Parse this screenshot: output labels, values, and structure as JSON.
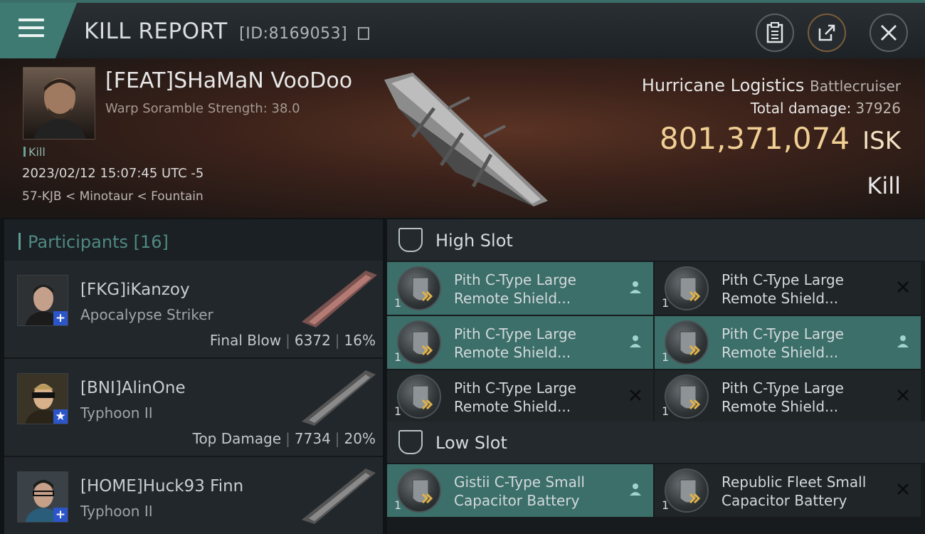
{
  "header": {
    "title": "KILL REPORT",
    "id_label": "[ID:8169053]"
  },
  "victim": {
    "name": "[FEAT]SHaMaN VooDoo",
    "sub": "Warp Soramble Strength: 38.0",
    "tag": "Kill",
    "time": "2023/02/12 15:07:45 UTC -5",
    "location": "57-KJB < Minotaur < Fountain",
    "ship_name": "Hurricane Logistics",
    "ship_class": "Battlecruiser",
    "total_damage_label": "Total damage:",
    "total_damage": "37926",
    "isk_value": "801,371,074",
    "isk_unit": "ISK",
    "result": "Kill"
  },
  "participants": {
    "label": "Participants",
    "count": "[16]",
    "rows": [
      {
        "name": "[FKG]iKanzoy",
        "ship": "Apocalypse Striker",
        "role": "Final Blow",
        "damage": "6372",
        "pct": "16%",
        "badge": "+"
      },
      {
        "name": "[BNI]AlinOne",
        "ship": "Typhoon II",
        "role": "Top Damage",
        "damage": "7734",
        "pct": "20%",
        "badge": "★"
      },
      {
        "name": "[HOME]Huck93 Finn",
        "ship": "Typhoon II",
        "role": "",
        "damage": "",
        "pct": "",
        "badge": "+"
      }
    ]
  },
  "slots": {
    "high": {
      "label": "High Slot",
      "items": [
        {
          "name": "Pith C-Type Large Remote Shield...",
          "qty": "1",
          "status": "person",
          "active": true
        },
        {
          "name": "Pith C-Type Large Remote Shield...",
          "qty": "1",
          "status": "x",
          "active": false
        },
        {
          "name": "Pith C-Type Large Remote Shield...",
          "qty": "1",
          "status": "person",
          "active": true
        },
        {
          "name": "Pith C-Type Large Remote Shield...",
          "qty": "1",
          "status": "person",
          "active": true
        },
        {
          "name": "Pith C-Type Large Remote Shield...",
          "qty": "1",
          "status": "x",
          "active": false
        },
        {
          "name": "Pith C-Type Large Remote Shield...",
          "qty": "1",
          "status": "x",
          "active": false
        }
      ]
    },
    "low": {
      "label": "Low Slot",
      "items": [
        {
          "name": "Gistii C-Type Small Capacitor Battery",
          "qty": "1",
          "status": "person",
          "active": true
        },
        {
          "name": "Republic Fleet Small Capacitor Battery",
          "qty": "1",
          "status": "x",
          "active": false
        }
      ]
    }
  },
  "icons": [
    "menu-icon",
    "copy-icon",
    "clipboard-icon",
    "share-icon",
    "close-icon",
    "high-slot-icon",
    "low-slot-icon",
    "person-icon",
    "x-icon"
  ],
  "colors": {
    "accent": "#3e7a72",
    "isk": "#f0cf94",
    "active_item": "#3c6f69"
  }
}
